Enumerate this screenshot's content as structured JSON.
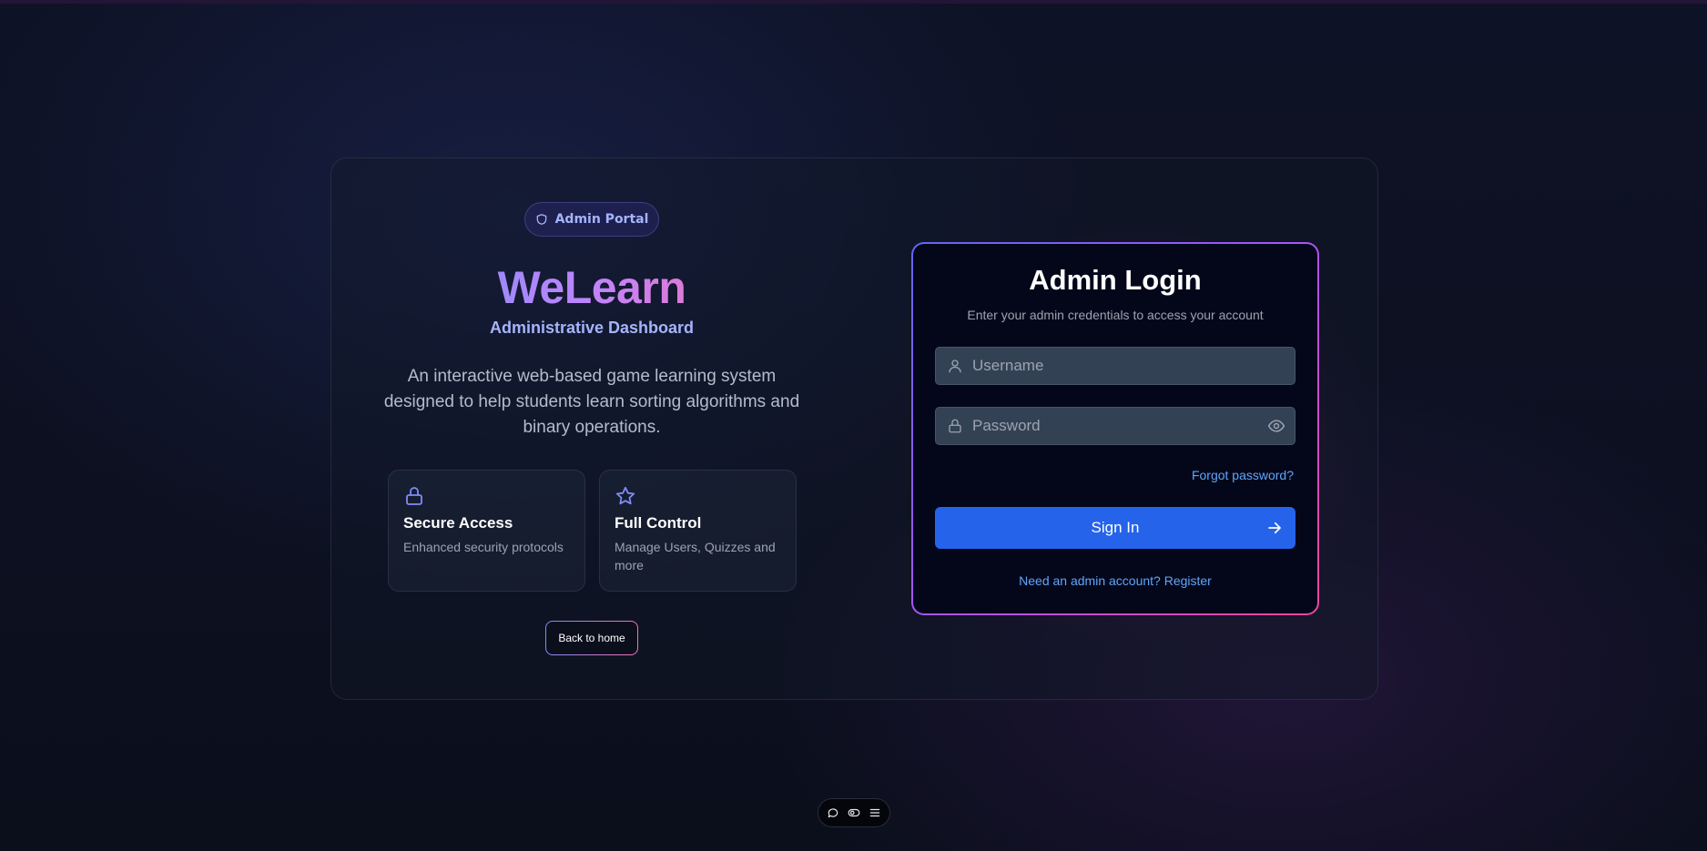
{
  "badge": {
    "label": "Admin Portal",
    "icon": "shield-icon"
  },
  "brand": {
    "name": "WeLearn",
    "subtitle": "Administrative Dashboard"
  },
  "description": "An interactive web-based game learning system designed to help students learn sorting algorithms and binary operations.",
  "features": [
    {
      "icon": "lock-icon",
      "title": "Secure Access",
      "desc": "Enhanced security protocols"
    },
    {
      "icon": "star-icon",
      "title": "Full Control",
      "desc": "Manage Users, Quizzes and more"
    }
  ],
  "back_button": "Back to home",
  "login": {
    "title": "Admin Login",
    "subtitle": "Enter your admin credentials to access your account",
    "username_placeholder": "Username",
    "password_placeholder": "Password",
    "forgot": "Forgot password?",
    "signin": "Sign In",
    "register": "Need an admin account? Register"
  },
  "toolbar": {
    "icons": [
      "chat-icon",
      "toggle-icon",
      "menu-icon"
    ]
  },
  "colors": {
    "accent_indigo": "#818cf8",
    "accent_pink": "#f472b6",
    "primary_button": "#2563eb",
    "link": "#60a5fa"
  }
}
